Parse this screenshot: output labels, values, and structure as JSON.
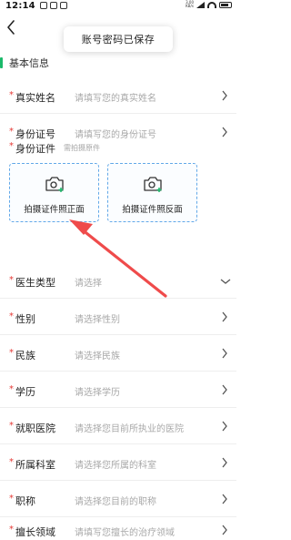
{
  "status_bar": {
    "time": "12:14",
    "net_speed_value": "3.00",
    "net_speed_unit": "KB/s"
  },
  "toast": {
    "text": "账号密码已保存"
  },
  "section": {
    "title": "基本信息"
  },
  "fields": [
    {
      "label": "真实姓名",
      "placeholder": "请填写您的真实姓名",
      "required": true,
      "chevron": "chevron-right"
    },
    {
      "label": "身份证号",
      "placeholder": "请填写您的身份证号",
      "required": true,
      "chevron": "chevron-right"
    }
  ],
  "id_document": {
    "label": "身份证件",
    "hint": "需拍摄原件",
    "front_label": "拍摄证件照正面",
    "back_label": "拍摄证件照反面"
  },
  "fields2": [
    {
      "label": "医生类型",
      "placeholder": "请选择",
      "required": true,
      "chevron": "chevron-down"
    },
    {
      "label": "性别",
      "placeholder": "请选择性别",
      "required": true,
      "chevron": "chevron-right"
    },
    {
      "label": "民族",
      "placeholder": "请选择民族",
      "required": true,
      "chevron": "chevron-right"
    },
    {
      "label": "学历",
      "placeholder": "请选择学历",
      "required": true,
      "chevron": "chevron-right"
    },
    {
      "label": "就职医院",
      "placeholder": "请选择您目前所执业的医院",
      "required": true,
      "chevron": "chevron-right"
    },
    {
      "label": "所属科室",
      "placeholder": "请选择您所属的科室",
      "required": true,
      "chevron": "chevron-right"
    },
    {
      "label": "职称",
      "placeholder": "请选择您目前的职称",
      "required": true,
      "chevron": "chevron-right"
    },
    {
      "label": "擅长领域",
      "placeholder": "请填写您擅长的治疗领域",
      "required": true,
      "chevron": "chevron-right"
    }
  ],
  "colors": {
    "accent": "#1bb96a",
    "required": "#e53935",
    "upload_border": "#62a8e8",
    "annotation_arrow": "#ef4b4b"
  }
}
